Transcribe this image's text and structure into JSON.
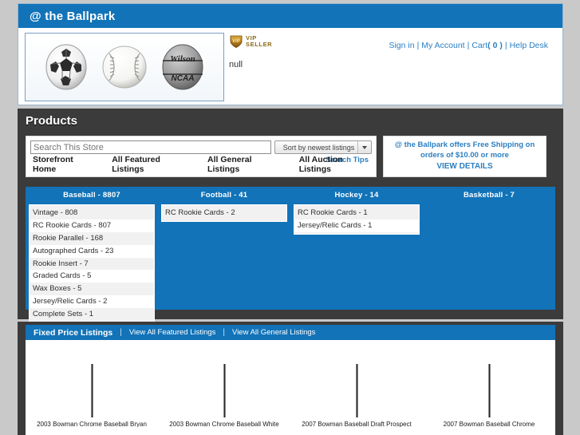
{
  "header": {
    "store_title": "@ the Ballpark",
    "logo_balls": [
      "soccer-ball",
      "baseball",
      "basketball-wilson-ncaa"
    ],
    "vip_badge": {
      "line1": "VIP",
      "line2": "SELLER"
    },
    "seller_note": "null",
    "account_links": {
      "sign_in": "Sign in",
      "my_account": "My Account",
      "cart_label": "Cart",
      "cart_count": "( 0 )",
      "help_desk": "Help Desk",
      "separator": "|"
    }
  },
  "products": {
    "title": "Products",
    "search": {
      "placeholder": "Search This Store",
      "value": "",
      "sort_selected": "Sort by newest listings",
      "search_tips": "Search Tips"
    },
    "nav": [
      {
        "label": "Storefront Home"
      },
      {
        "label": "All Featured Listings"
      },
      {
        "label": "All General Listings"
      },
      {
        "label": "All Auction Listings"
      }
    ],
    "promo": {
      "line1": "@ the Ballpark offers Free Shipping on",
      "line2": "orders of $10.00 or more",
      "line3": "VIEW DETAILS"
    },
    "categories": [
      {
        "heading": "Baseball - 8807",
        "items": [
          "Vintage - 808",
          "RC Rookie Cards - 807",
          "Rookie Parallel - 168",
          "Autographed Cards - 23",
          "Rookie Insert - 7",
          "Graded Cards - 5",
          "Wax Boxes - 5",
          "Jersey/Relic Cards - 2",
          "Complete Sets - 1"
        ]
      },
      {
        "heading": "Football - 41",
        "items": [
          "RC Rookie Cards - 2"
        ]
      },
      {
        "heading": "Hockey - 14",
        "items": [
          "RC Rookie Cards - 1",
          "Jersey/Relic Cards - 1"
        ]
      },
      {
        "heading": "Basketball - 7",
        "items": []
      }
    ]
  },
  "listings": {
    "bar": {
      "title": "Fixed Price Listings",
      "sep": "|",
      "link_featured": "View All Featured Listings",
      "link_general": "View All General Listings"
    },
    "items": [
      {
        "title": "2003 Bowman Chrome Baseball Bryan"
      },
      {
        "title": "2003 Bowman Chrome Baseball White"
      },
      {
        "title": "2007 Bowman Baseball Draft Prospect"
      },
      {
        "title": "2007 Bowman Baseball Chrome"
      }
    ]
  },
  "colors": {
    "brand_blue": "#1273b8",
    "dark_panel": "#3b3b3b",
    "page_gray": "#c9c9c9",
    "link_blue": "#2b7fc2"
  }
}
